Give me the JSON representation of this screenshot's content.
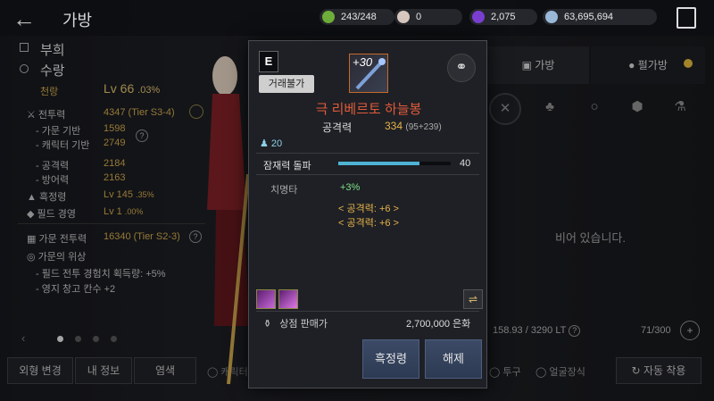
{
  "app": {
    "title": "가방"
  },
  "resources": [
    {
      "icon": "stamina-icon",
      "value": "243/248",
      "color": "#6fae3a"
    },
    {
      "icon": "pearl-icon",
      "value": "0",
      "color": "#d8c8c0"
    },
    {
      "icon": "crystal-icon",
      "value": "2,075",
      "color": "#7a3fd1"
    },
    {
      "icon": "silver-icon",
      "value": "63,695,694",
      "color": "#9ab8d8"
    }
  ],
  "left": {
    "family": "부희",
    "name": "수랑",
    "rank_label": "천랑",
    "level": "Lv 66",
    "level_pct": ".03%",
    "combat_label": "전투력",
    "combat_val": "4347 (Tier S3-4)",
    "family_base_label": "가문 기반",
    "family_base_val": "1598",
    "char_base_label": "캐릭터 기반",
    "char_base_val": "2749",
    "attack_label": "공격력",
    "attack_val": "2184",
    "defense_label": "방어력",
    "defense_val": "2163",
    "blackspirit_label": "흑정령",
    "blackspirit_val": "Lv 145",
    ".": "",
    "blackspirit_pct": ".35%",
    "field_label": "필드 경영",
    "field_val": "Lv 1",
    "field_pct": ".00%",
    "family_combat_label": "가문 전투력",
    "family_combat_val": "16340 (Tier S2-3)",
    "prestige_label": "가문의 위상",
    "bonus1": "필드 전투 경험치 획득량: +5%",
    "bonus2": "영지 창고 칸수 +2",
    "btn_appearance": "외형 변경",
    "btn_info": "내 정보",
    "btn_dye": "염색",
    "chk_char": "캐릭터 외형"
  },
  "right": {
    "tab_bag": "가방",
    "tab_family_bag": "펄가방",
    "empty_text": "비어 있습니다.",
    "weight": "158.93 / 3290 LT",
    "slots": "71/300",
    "chk_helmet": "투구",
    "chk_face": "얼굴장식",
    "btn_auto": "자동 착용"
  },
  "item": {
    "grade": "E",
    "trade": "거래불가",
    "level": "+30",
    "name": "극 리베르토 하늘봉",
    "atk_label": "공격력",
    "atk_val": "334",
    "atk_detail": "(95+239)",
    "req": "20",
    "awaken_label": "잠재력 돌파",
    "awaken_val": "40",
    "awaken_fill": 0.72,
    "crit_label": "치명타",
    "crit_val": "+3%",
    "bonus1": "< 공격력: +6 >",
    "bonus2": "< 공격력: +6 >",
    "sell_label": "상점 판매가",
    "sell_val": "2,700,000 은화",
    "btn_blackspirit": "흑정령",
    "btn_unequip": "해제"
  }
}
